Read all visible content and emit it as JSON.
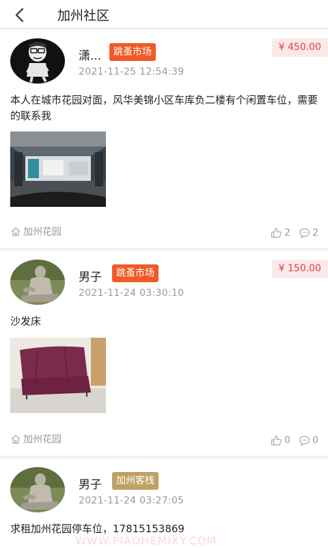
{
  "header": {
    "title": "加州社区"
  },
  "posts": [
    {
      "username": "潇...",
      "tag": "跳蚤市场",
      "price": "¥ 450.00",
      "time": "2021-11-25 12:54:39",
      "content": "本人在城市花园对面，风华美锦小区车库负二楼有个闲置车位，需要的联系我",
      "location": "加州花园",
      "likes": "2",
      "comments": "2"
    },
    {
      "username": "男子",
      "tag": "跳蚤市场",
      "price": "¥ 150.00",
      "time": "2021-11-24 03:30:10",
      "content": "沙发床",
      "location": "加州花园",
      "likes": "0",
      "comments": "0"
    },
    {
      "username": "男子",
      "tag": "加州客栈",
      "time": "2021-11-24 03:27:05",
      "content": "求租加州花园停车位，17815153869"
    }
  ],
  "watermark": "WWW.PIAOHEMIXY.COM",
  "colors": {
    "accent": "#f05a26",
    "tag_gold": "#c0a065",
    "price": "#e33d3d",
    "price_bg": "#fbe9e9"
  }
}
